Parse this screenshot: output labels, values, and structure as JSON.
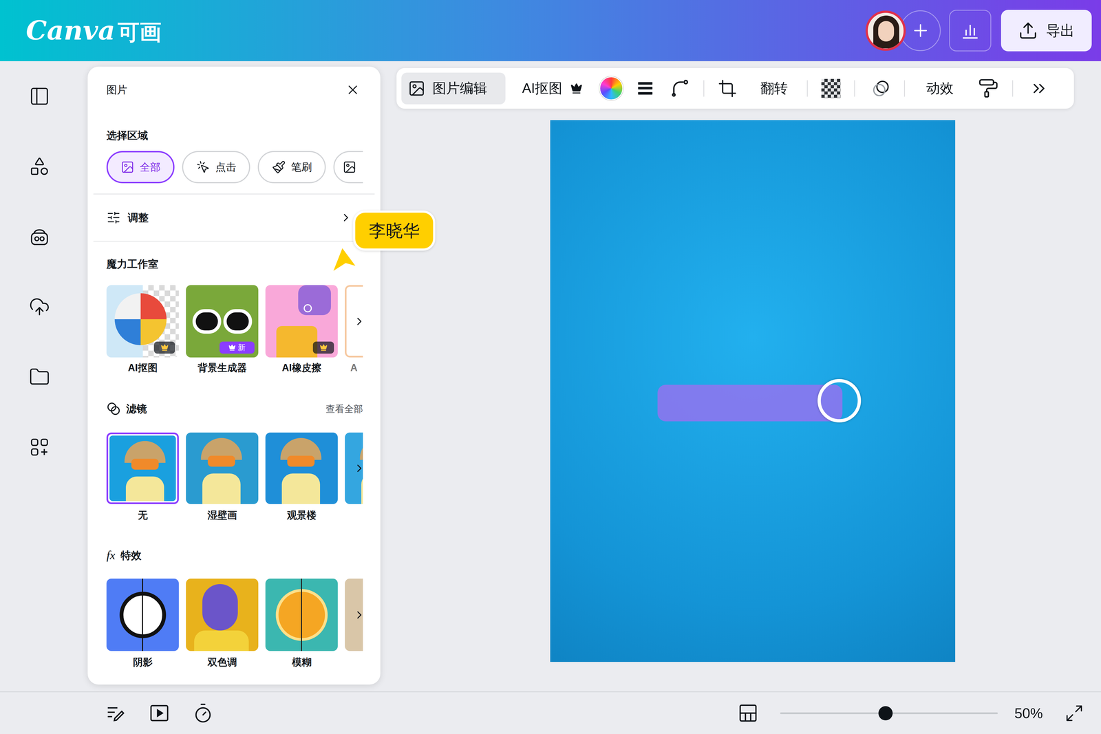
{
  "brand": {
    "latin": "Canva",
    "chinese": "可画"
  },
  "header": {
    "export_button": "导出"
  },
  "panel": {
    "title": "图片",
    "select_region": {
      "label": "选择区域",
      "chips": [
        {
          "label": "全部",
          "kind": "all",
          "selected": true
        },
        {
          "label": "点击",
          "kind": "click",
          "selected": false
        },
        {
          "label": "笔刷",
          "kind": "brush",
          "selected": false
        },
        {
          "label": "",
          "kind": "partial",
          "selected": false
        }
      ]
    },
    "adjust": {
      "label": "调整"
    },
    "magic_studio": {
      "title": "魔力工作室",
      "tools": [
        {
          "label": "AI抠图",
          "premium": true,
          "badge": "",
          "kind": "full"
        },
        {
          "label": "背景生成器",
          "premium": true,
          "badge": "新",
          "kind": "full"
        },
        {
          "label": "AI橡皮擦",
          "premium": true,
          "badge": "",
          "kind": "full"
        },
        {
          "label": "A",
          "premium": false,
          "badge": "",
          "kind": "partial"
        }
      ]
    },
    "filters": {
      "title": "滤镜",
      "view_all": "查看全部",
      "items": [
        {
          "label": "无",
          "selected": true,
          "kind": "full"
        },
        {
          "label": "湿壁画",
          "selected": false,
          "kind": "full"
        },
        {
          "label": "观景楼",
          "selected": false,
          "kind": "full"
        },
        {
          "label": "",
          "selected": false,
          "kind": "partial"
        }
      ]
    },
    "effects": {
      "title": "特效",
      "icon_text": "fx",
      "items": [
        {
          "label": "阴影",
          "kind": "full"
        },
        {
          "label": "双色调",
          "kind": "full"
        },
        {
          "label": "模糊",
          "kind": "full"
        },
        {
          "label": "",
          "kind": "partial"
        }
      ]
    }
  },
  "toolbar": {
    "items": [
      {
        "label": "图片编辑",
        "selected": true
      },
      {
        "label": "AI抠图",
        "selected": false
      },
      {
        "label": "翻转",
        "selected": false
      },
      {
        "label": "动效",
        "selected": false
      }
    ]
  },
  "collaborator": {
    "name": "李晓华"
  },
  "zoom": {
    "level": 0.484,
    "reading": "50%"
  }
}
